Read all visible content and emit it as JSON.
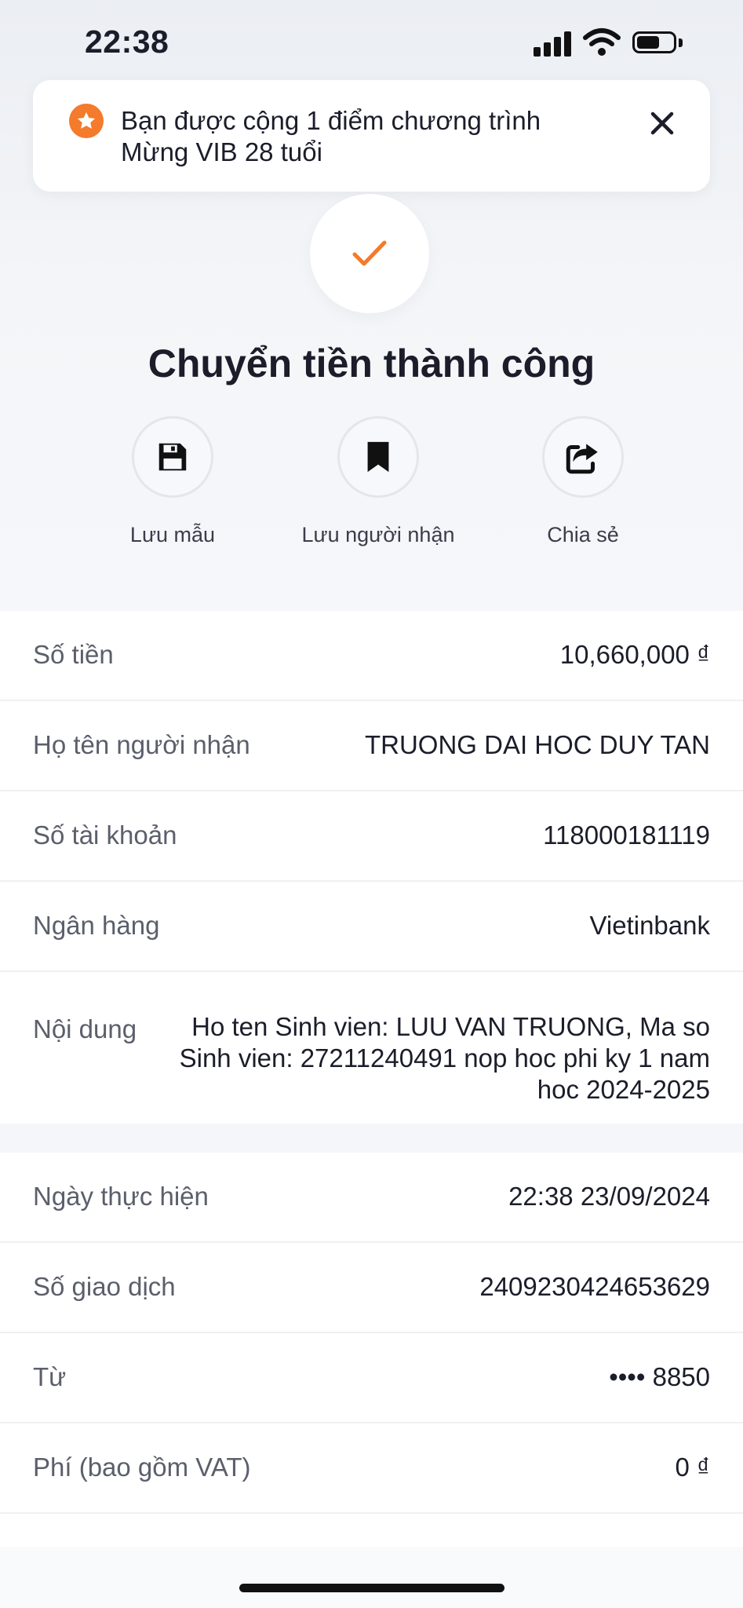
{
  "status_bar": {
    "time": "22:38"
  },
  "toast": {
    "message": "Bạn được cộng 1 điểm chương trình Mừng VIB 28 tuổi",
    "icon": "star-icon",
    "close_icon": "close-icon"
  },
  "result": {
    "title": "Chuyển tiền thành công",
    "icon": "checkmark-icon",
    "accent_color": "#f47a2c"
  },
  "actions": [
    {
      "label": "Lưu mẫu",
      "icon": "floppy-disk-icon"
    },
    {
      "label": "Lưu người nhận",
      "icon": "bookmark-icon"
    },
    {
      "label": "Chia sẻ",
      "icon": "share-icon"
    }
  ],
  "transfer_details": [
    {
      "label": "Số tiền",
      "value": "10,660,000 ₫"
    },
    {
      "label": "Họ tên người nhận",
      "value": "TRUONG DAI HOC DUY TAN"
    },
    {
      "label": "Số tài khoản",
      "value": "118000181119"
    },
    {
      "label": "Ngân hàng",
      "value": "Vietinbank"
    },
    {
      "label": "Nội dung",
      "value": "Ho ten Sinh vien: LUU VAN TRUONG, Ma so Sinh vien: 27211240491 nop hoc phi ky 1 nam hoc 2024-2025"
    }
  ],
  "transaction_details": [
    {
      "label": "Ngày thực hiện",
      "value": "22:38 23/09/2024"
    },
    {
      "label": "Số giao dịch",
      "value": "2409230424653629"
    },
    {
      "label": "Từ",
      "value": "•••• 8850"
    },
    {
      "label": "Phí (bao gồm VAT)",
      "value": "0 ₫"
    }
  ]
}
